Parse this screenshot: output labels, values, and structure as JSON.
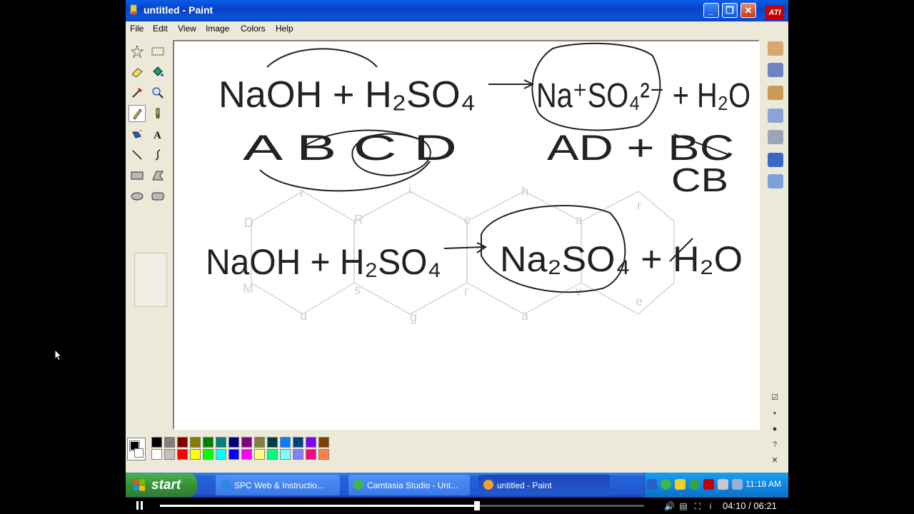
{
  "window": {
    "title": "untitled - Paint",
    "minimize": "_",
    "restore": "❐",
    "close": "✕",
    "brand_logo": "ATI"
  },
  "menu": [
    "File",
    "Edit",
    "View",
    "Image",
    "Colors",
    "Help"
  ],
  "tools": [
    {
      "icon": "free-select-icon",
      "glyph": "☆"
    },
    {
      "icon": "rect-select-icon",
      "glyph": "▭"
    },
    {
      "icon": "eraser-icon",
      "glyph": "▰"
    },
    {
      "icon": "fill-icon",
      "glyph": "◈"
    },
    {
      "icon": "color-picker-icon",
      "glyph": "✎"
    },
    {
      "icon": "magnifier-icon",
      "glyph": "🔍"
    },
    {
      "icon": "pencil-icon",
      "glyph": "✏"
    },
    {
      "icon": "brush-icon",
      "glyph": "🖌"
    },
    {
      "icon": "airbrush-icon",
      "glyph": "⋰"
    },
    {
      "icon": "text-icon",
      "glyph": "A"
    },
    {
      "icon": "line-icon",
      "glyph": "╲"
    },
    {
      "icon": "curve-icon",
      "glyph": "∫"
    },
    {
      "icon": "rectangle-icon",
      "glyph": "▭"
    },
    {
      "icon": "polygon-icon",
      "glyph": "⬠"
    },
    {
      "icon": "ellipse-icon",
      "glyph": "⬭"
    },
    {
      "icon": "rounded-rect-icon",
      "glyph": "▢"
    }
  ],
  "selected_tool": "pencil-icon",
  "palette": {
    "foreground": "#000000",
    "background": "#ffffff",
    "row1": [
      "#000000",
      "#808080",
      "#800000",
      "#808000",
      "#008000",
      "#008080",
      "#000080",
      "#800080",
      "#808040",
      "#004040",
      "#0080ff",
      "#004080",
      "#8000ff",
      "#804000"
    ],
    "row2": [
      "#ffffff",
      "#c0c0c0",
      "#ff0000",
      "#ffff00",
      "#00ff00",
      "#00ffff",
      "#0000ff",
      "#ff00ff",
      "#ffff80",
      "#00ff80",
      "#80ffff",
      "#8080ff",
      "#ff0080",
      "#ff8040"
    ]
  },
  "canvas": {
    "handwriting": {
      "line1_left": "NaOH + H₂SO₄",
      "line1_right": "Na⁺SO₄²⁻ + H₂O",
      "line2_left": "A B   C  D",
      "line2_right": "AD + BC",
      "line2_right_sub": "CB",
      "line3_left": "NaOH + H₂SO₄",
      "line3_right": "Na₂SO₄ + H₂O"
    },
    "watermark_letters": [
      "r",
      "i",
      "h",
      "D",
      "R",
      "c",
      "a",
      "r",
      "M",
      "s",
      "r",
      "v",
      "e",
      "u",
      "g",
      "a"
    ]
  },
  "taskbar": {
    "start_label": "start",
    "buttons": [
      {
        "label": "SPC Web & Instructio...",
        "icon": "browser-icon",
        "color": "#2d88e0"
      },
      {
        "label": "Camtasia Studio - Unt...",
        "icon": "camtasia-icon",
        "color": "#3cb84a"
      },
      {
        "label": "untitled - Paint",
        "icon": "paint-icon",
        "color": "#f0a030"
      }
    ],
    "clock": "11:18 AM"
  },
  "player": {
    "time": "04:10 / 06:21",
    "progress": 0.655
  }
}
